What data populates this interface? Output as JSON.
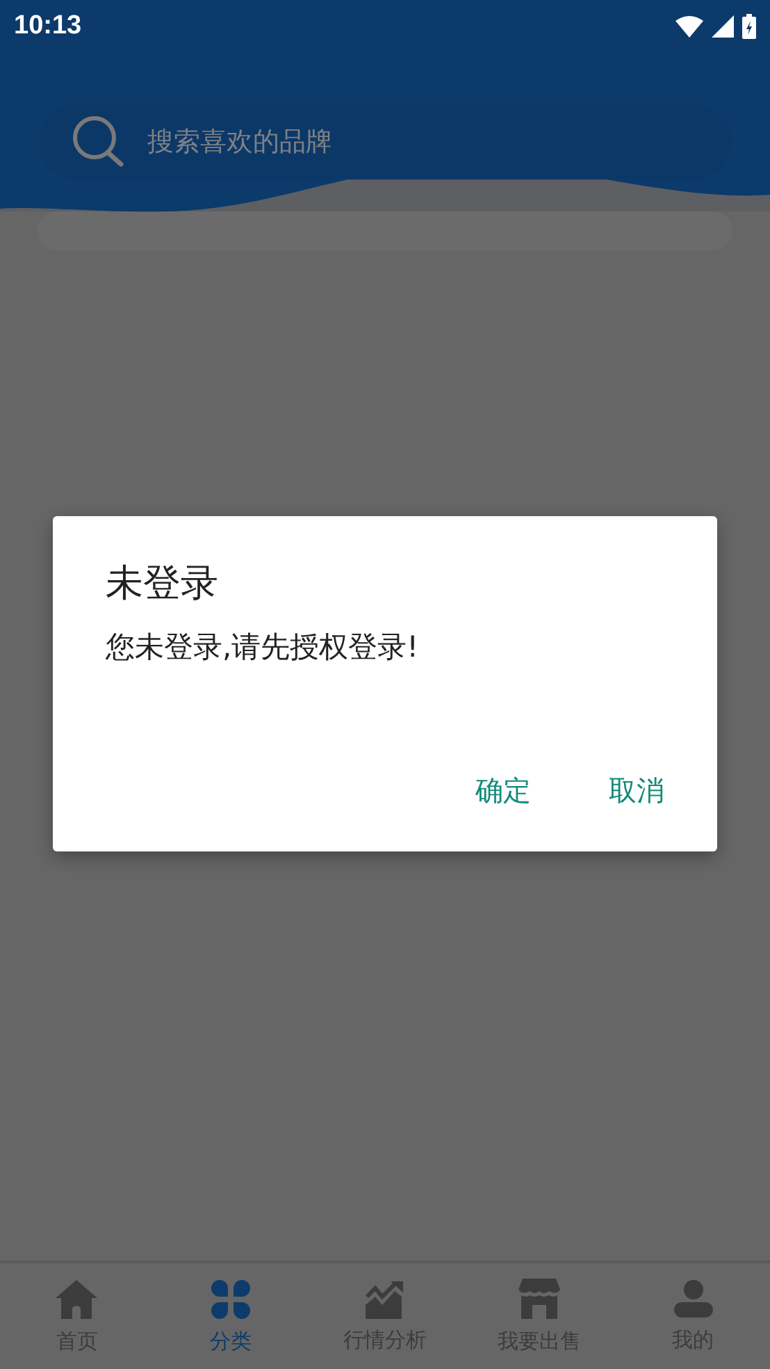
{
  "status_bar": {
    "time": "10:13"
  },
  "search": {
    "placeholder": "搜索喜欢的品牌"
  },
  "dialog": {
    "title": "未登录",
    "message": "您未登录,请先授权登录!",
    "buttons": [
      "确定",
      "取消"
    ]
  },
  "tab_bar": [
    {
      "label": "首页",
      "selected": false
    },
    {
      "label": "分类",
      "selected": true
    },
    {
      "label": "行情分析",
      "selected": false
    },
    {
      "label": "我要出售",
      "selected": false
    },
    {
      "label": "我的",
      "selected": false
    }
  ]
}
